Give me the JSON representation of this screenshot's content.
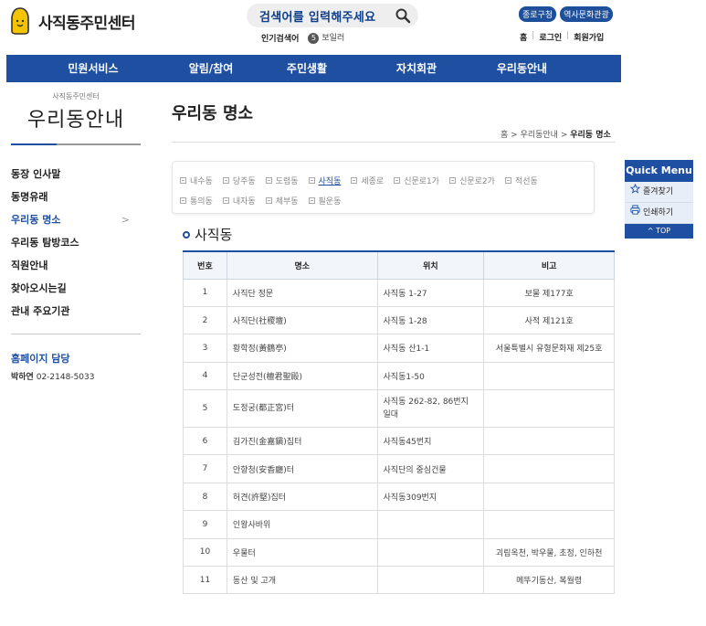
{
  "header": {
    "logo_text": "사직동주민센터",
    "search_placeholder": "검색어를 입력해주세요",
    "popular_label": "인기검색어",
    "popular_rank": "5",
    "popular_term": "보일러",
    "badges": [
      "종로구청",
      "역사문화관광"
    ],
    "util_links": [
      "홈",
      "로그인",
      "회원가입"
    ]
  },
  "gnb": [
    "민원서비스",
    "알림/참여",
    "주민생활",
    "자치회관",
    "우리동안내"
  ],
  "lnb": {
    "small_title": "사직동주민센터",
    "title": "우리동안내",
    "menu": [
      "동장 인사말",
      "동명유래",
      "우리동 명소",
      "우리동 탐방코스",
      "직원안내",
      "찾아오시는길",
      "관내 주요기관"
    ],
    "active_index": 2,
    "manager_title": "홈페이지 담당",
    "manager_name": "박하연",
    "manager_phone": "02-2148-5033"
  },
  "content": {
    "page_title": "우리동 명소",
    "breadcrumb": [
      "홈",
      "우리동안내",
      "우리동 명소"
    ],
    "tabs_row1": [
      "내수동",
      "당주동",
      "도렴동",
      "사직동",
      "세종로",
      "신문로1가",
      "신문로2가",
      "적선동"
    ],
    "tabs_row2": [
      "통의동",
      "내자동",
      "체부동",
      "필운동"
    ],
    "active_tab": "사직동",
    "section_title": "사직동",
    "table_headers": [
      "번호",
      "명소",
      "위치",
      "비고"
    ],
    "rows": [
      [
        "1",
        "사직단 정문",
        "사직동 1-27",
        "보물 제177호"
      ],
      [
        "2",
        "사직단(社稷壇)",
        "사직동 1-28",
        "사적 제121호"
      ],
      [
        "3",
        "황학정(黃鶴亭)",
        "사직동 산1-1",
        "서울특별시 유형문화재 제25호"
      ],
      [
        "4",
        "단군성전(檀君聖殿)",
        "사직동1-50",
        ""
      ],
      [
        "5",
        "도정궁(都正宮)터",
        "사직동 262-82, 86번지 일대",
        ""
      ],
      [
        "6",
        "김가진(金嘉鎭)집터",
        "사직동45번지",
        ""
      ],
      [
        "7",
        "안향청(安香廳)터",
        "사직단의 중심건물",
        ""
      ],
      [
        "8",
        "허견(許堅)집터",
        "사직동309번지",
        ""
      ],
      [
        "9",
        "인왕사바위",
        "",
        ""
      ],
      [
        "10",
        "우물터",
        "",
        "괴림옥천, 박우물, 초정, 인하천"
      ],
      [
        "11",
        "동산 및 고개",
        "",
        "메뚜기동산, 복월령"
      ]
    ]
  },
  "quick_menu": {
    "title": "Quick Menu",
    "items": [
      "즐겨찾기",
      "인쇄하기"
    ],
    "top_label": "TOP"
  },
  "colors": {
    "primary": "#1e4fa0",
    "logo_yellow": "#f5c400"
  }
}
